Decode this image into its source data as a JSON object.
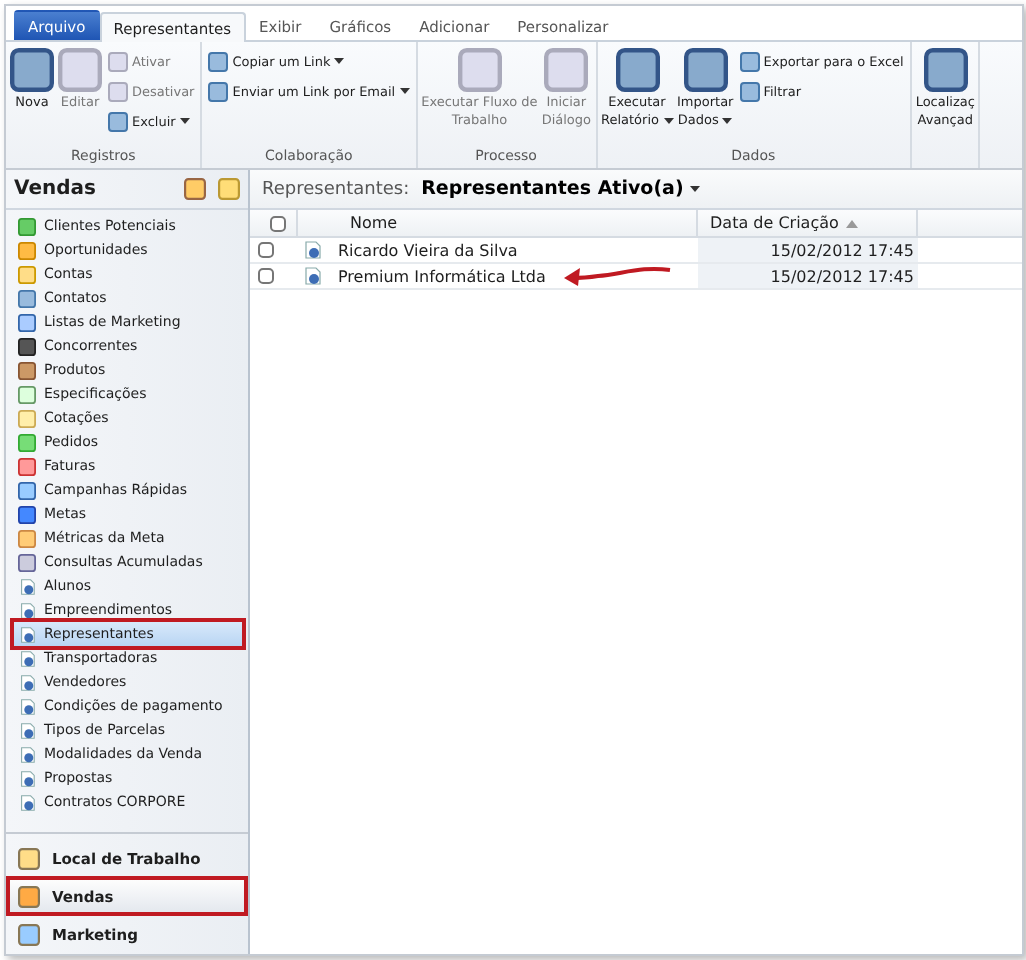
{
  "ribbon": {
    "tabs": [
      {
        "label": "Arquivo",
        "kind": "file",
        "selected": false
      },
      {
        "label": "Representantes",
        "kind": "tab",
        "selected": true
      },
      {
        "label": "Exibir",
        "kind": "tab",
        "selected": false
      },
      {
        "label": "Gráficos",
        "kind": "tab",
        "selected": false
      },
      {
        "label": "Adicionar",
        "kind": "tab",
        "selected": false
      },
      {
        "label": "Personalizar",
        "kind": "tab",
        "selected": false
      }
    ],
    "groups": [
      {
        "label": "Registros",
        "buttons": [
          {
            "kind": "large",
            "lines": [
              "Nova"
            ],
            "disabled": false,
            "dropdown": false
          },
          {
            "kind": "large",
            "lines": [
              "Editar"
            ],
            "disabled": true,
            "dropdown": false
          },
          {
            "kind": "stack",
            "items": [
              {
                "label": "Ativar",
                "disabled": true,
                "dropdown": false
              },
              {
                "label": "Desativar",
                "disabled": true,
                "dropdown": false
              },
              {
                "label": "Excluir",
                "disabled": false,
                "dropdown": true
              }
            ]
          }
        ]
      },
      {
        "label": "Colaboração",
        "buttons": [
          {
            "kind": "stack",
            "items": [
              {
                "label": "Copiar um Link",
                "disabled": false,
                "dropdown": true
              },
              {
                "label": "Enviar um Link por Email",
                "disabled": false,
                "dropdown": true
              }
            ]
          }
        ]
      },
      {
        "label": "Processo",
        "buttons": [
          {
            "kind": "large",
            "lines": [
              "Executar Fluxo de",
              "Trabalho"
            ],
            "disabled": true,
            "dropdown": false
          },
          {
            "kind": "large",
            "lines": [
              "Iniciar",
              "Diálogo"
            ],
            "disabled": true,
            "dropdown": false
          }
        ]
      },
      {
        "label": "Dados",
        "buttons": [
          {
            "kind": "large",
            "lines": [
              "Executar",
              "Relatório"
            ],
            "disabled": false,
            "dropdown": true
          },
          {
            "kind": "large",
            "lines": [
              "Importar",
              "Dados"
            ],
            "disabled": false,
            "dropdown": true
          },
          {
            "kind": "stack",
            "items": [
              {
                "label": "Exportar para o Excel",
                "disabled": false,
                "dropdown": false
              },
              {
                "label": "Filtrar",
                "disabled": false,
                "dropdown": false
              }
            ]
          }
        ]
      },
      {
        "buttons": [
          {
            "kind": "large",
            "lines": [
              "Localizaç",
              "Avançad"
            ],
            "disabled": false,
            "dropdown": false
          }
        ]
      }
    ]
  },
  "sidebar": {
    "title": "Vendas",
    "items": [
      {
        "label": "Clientes Potenciais",
        "selected": false
      },
      {
        "label": "Oportunidades",
        "selected": false
      },
      {
        "label": "Contas",
        "selected": false
      },
      {
        "label": "Contatos",
        "selected": false
      },
      {
        "label": "Listas de Marketing",
        "selected": false
      },
      {
        "label": "Concorrentes",
        "selected": false
      },
      {
        "label": "Produtos",
        "selected": false
      },
      {
        "label": "Especificações",
        "selected": false
      },
      {
        "label": "Cotações",
        "selected": false
      },
      {
        "label": "Pedidos",
        "selected": false
      },
      {
        "label": "Faturas",
        "selected": false
      },
      {
        "label": "Campanhas Rápidas",
        "selected": false
      },
      {
        "label": "Metas",
        "selected": false
      },
      {
        "label": "Métricas da Meta",
        "selected": false
      },
      {
        "label": "Consultas Acumuladas",
        "selected": false
      },
      {
        "label": "Alunos",
        "selected": false
      },
      {
        "label": "Empreendimentos",
        "selected": false
      },
      {
        "label": "Representantes",
        "selected": true
      },
      {
        "label": "Transportadoras",
        "selected": false
      },
      {
        "label": "Vendedores",
        "selected": false
      },
      {
        "label": "Condições de pagamento",
        "selected": false
      },
      {
        "label": "Tipos de Parcelas",
        "selected": false
      },
      {
        "label": "Modalidades da Venda",
        "selected": false
      },
      {
        "label": "Propostas",
        "selected": false
      },
      {
        "label": "Contratos CORPORE",
        "selected": false
      }
    ],
    "areas": [
      {
        "label": "Local de Trabalho",
        "selected": false
      },
      {
        "label": "Vendas",
        "selected": true
      },
      {
        "label": "Marketing",
        "selected": false
      }
    ]
  },
  "view": {
    "label": "Representantes:",
    "name": "Representantes Ativo(a)",
    "all_checked": false,
    "columns": [
      "Nome",
      "Data de Criação"
    ],
    "rows": [
      {
        "name": "Ricardo Vieira da Silva",
        "date": "15/02/2012 17:45",
        "checked": false,
        "pointed": false
      },
      {
        "name": "Premium Informática Ltda",
        "date": "15/02/2012 17:45",
        "checked": false,
        "pointed": true
      }
    ]
  }
}
